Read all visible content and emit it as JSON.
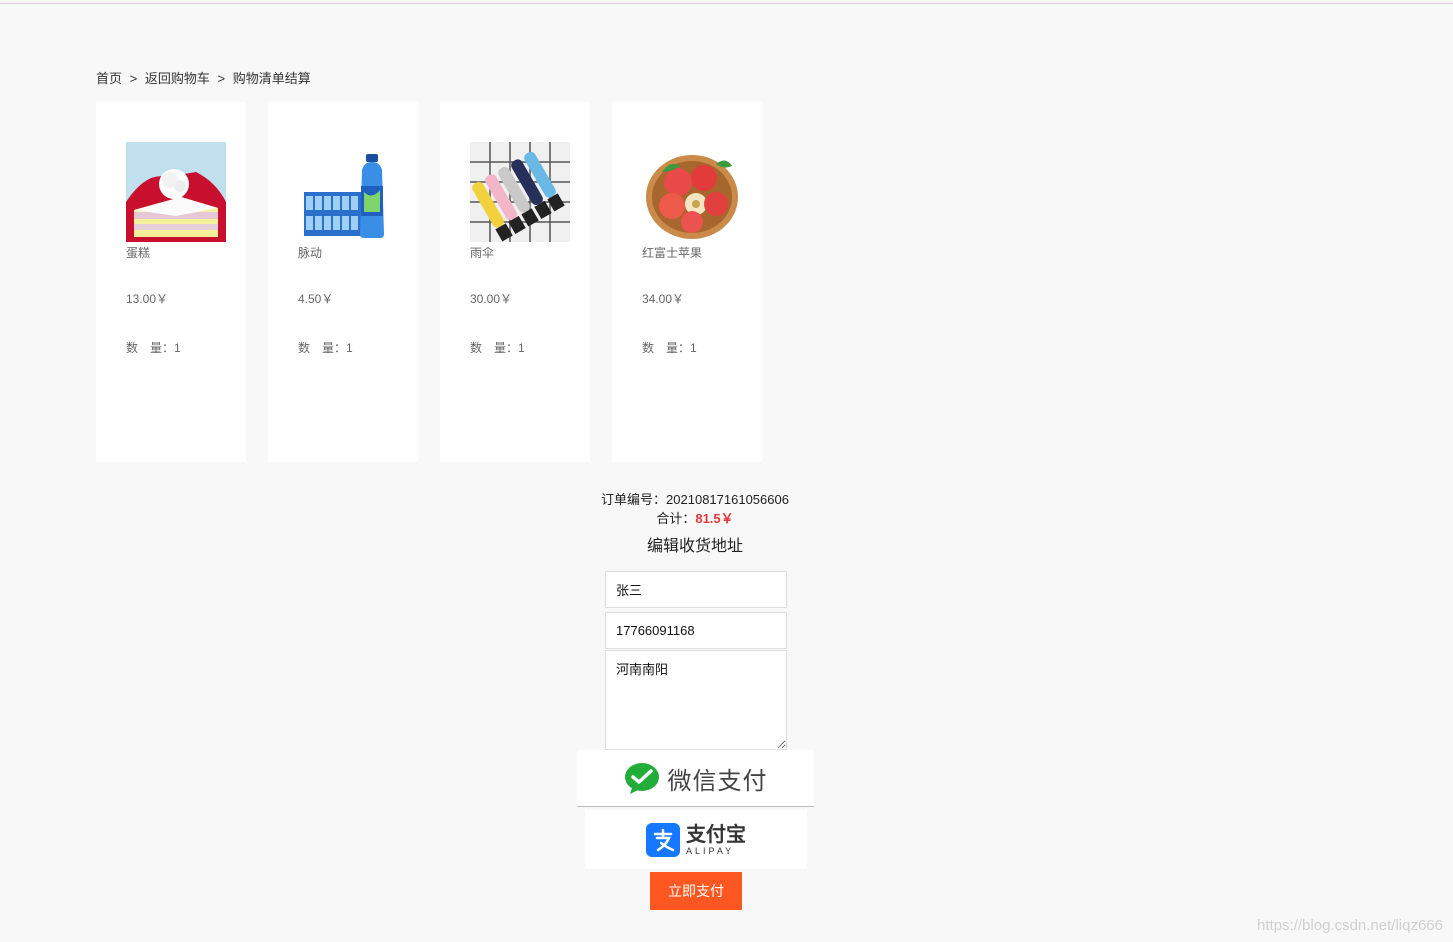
{
  "breadcrumb": {
    "home": "首页",
    "separator": ">",
    "back_to_cart": "返回购物车",
    "current": "购物清单结算"
  },
  "products": [
    {
      "name": "蛋糕",
      "price": "13.00￥",
      "qty_label": "数　量：",
      "qty": "1",
      "image_icon": "cake-image"
    },
    {
      "name": "脉动",
      "price": "4.50￥",
      "qty_label": "数　量：",
      "qty": "1",
      "image_icon": "drink-bottle-image"
    },
    {
      "name": "雨伞",
      "price": "30.00￥",
      "qty_label": "数　量：",
      "qty": "1",
      "image_icon": "umbrella-image"
    },
    {
      "name": "红富士苹果",
      "price": "34.00￥",
      "qty_label": "数　量：",
      "qty": "1",
      "image_icon": "apple-basket-image"
    }
  ],
  "order": {
    "number_label": "订单编号：",
    "number": "20210817161056606",
    "total_label": "合计：",
    "total_value": "81.5￥"
  },
  "address": {
    "title": "编辑收货地址",
    "name": "张三",
    "phone": "17766091168",
    "address": "河南南阳"
  },
  "payment": {
    "wechat_label": "微信支付",
    "alipay_cn": "支付宝",
    "alipay_en": "ALIPAY",
    "pay_now": "立即支付"
  },
  "watermark": "https://blog.csdn.net/liqz666",
  "colors": {
    "accent": "#ff5722",
    "total_red": "#e4393c",
    "wechat_green": "#22ac38",
    "alipay_blue": "#1678ff"
  }
}
